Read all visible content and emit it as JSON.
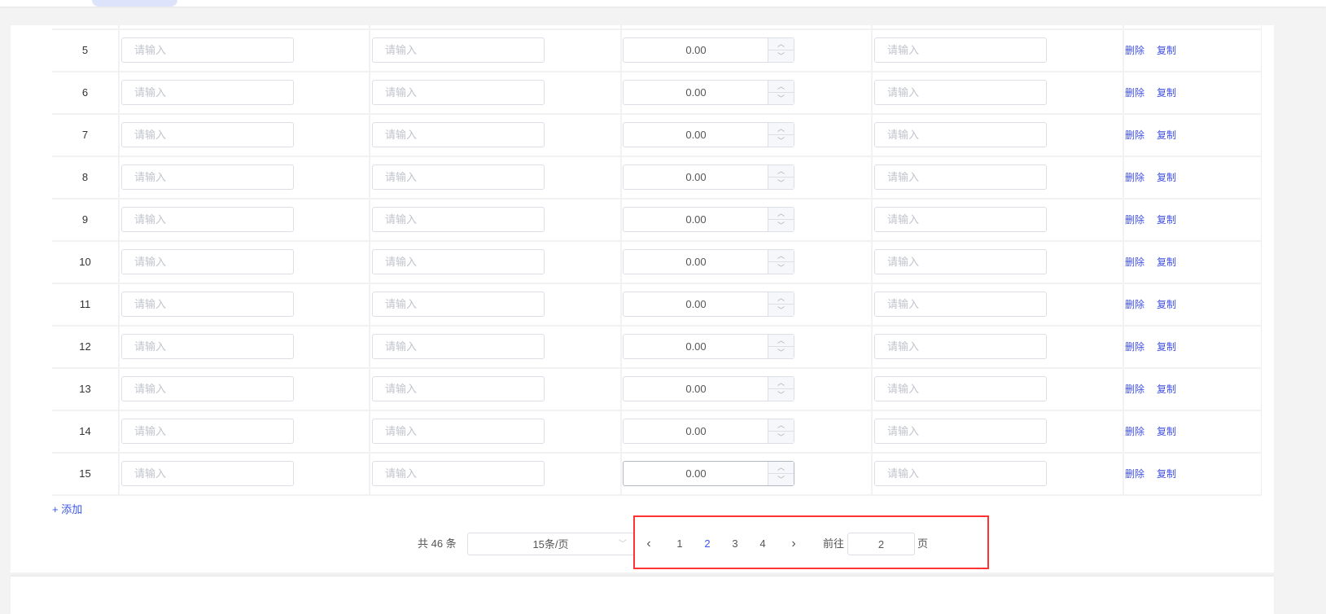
{
  "table": {
    "placeholder": "请输入",
    "rows": [
      {
        "index": "5",
        "amount": "0.00"
      },
      {
        "index": "6",
        "amount": "0.00"
      },
      {
        "index": "7",
        "amount": "0.00"
      },
      {
        "index": "8",
        "amount": "0.00"
      },
      {
        "index": "9",
        "amount": "0.00"
      },
      {
        "index": "10",
        "amount": "0.00"
      },
      {
        "index": "11",
        "amount": "0.00"
      },
      {
        "index": "12",
        "amount": "0.00"
      },
      {
        "index": "13",
        "amount": "0.00"
      },
      {
        "index": "14",
        "amount": "0.00"
      },
      {
        "index": "15",
        "amount": "0.00"
      }
    ],
    "delete_label": "删除",
    "copy_label": "复制"
  },
  "add_label": "+ 添加",
  "pagination": {
    "total": "共 46 条",
    "page_size": "15条/页",
    "prev": "‹",
    "pages": [
      "1",
      "2",
      "3",
      "4"
    ],
    "current": "2",
    "next": "›",
    "goto_label": "前往",
    "goto_value": "2",
    "page_suffix": "页"
  },
  "colors": {
    "accent": "#3a57e8",
    "highlight": "#ff3333"
  }
}
